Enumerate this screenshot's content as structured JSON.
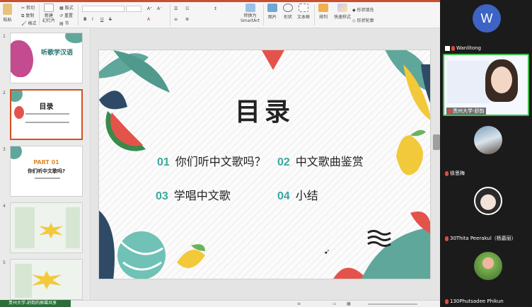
{
  "ribbon": {
    "paste_label": "粘贴",
    "cut_label": "剪切",
    "copy_label": "复制",
    "format_label": "格式",
    "new_slide_label": "新建\n幻灯片",
    "layout_label": "版式",
    "reset_label": "重置",
    "section_label": "节",
    "picture_label": "图片",
    "shape_label": "形状",
    "textbox_label": "文本框",
    "smartart_label": "转换为\nSmartArt",
    "arrange_label": "排列",
    "quickstyle_label": "快速样式",
    "shape_fill_label": "形状填充",
    "shape_outline_label": "形状轮廓",
    "accent_color": "#c8502f"
  },
  "thumbnails": [
    {
      "num": "1",
      "title": "听歌学汉语",
      "selected": false
    },
    {
      "num": "2",
      "title": "目录",
      "selected": true
    },
    {
      "num": "3",
      "title": "PART 01",
      "subtitle": "你们听中文歌吗?",
      "selected": false
    },
    {
      "num": "4",
      "title": "",
      "selected": false
    },
    {
      "num": "5",
      "title": "",
      "selected": false
    }
  ],
  "slide": {
    "title": "目录",
    "items": [
      {
        "num": "01",
        "text": "你们听中文歌吗？"
      },
      {
        "num": "02",
        "text": "中文歌曲鉴赏"
      },
      {
        "num": "03",
        "text": "学唱中文歌"
      },
      {
        "num": "04",
        "text": "小结"
      }
    ]
  },
  "status": {
    "share_label": "贵州大学-舒韵的屏幕共享"
  },
  "participants": [
    {
      "name": "Wanlitong",
      "avatar_letter": "W",
      "type": "avatar"
    },
    {
      "name": "贵州大学-舒韵",
      "type": "video"
    },
    {
      "name": "徐思梅",
      "type": "photo"
    },
    {
      "name": "30Thita Peerakul（杨嘉丽）",
      "type": "photo"
    },
    {
      "name": "130Phutsadee Phikun",
      "type": "photo"
    }
  ],
  "colors": {
    "teal": "#3aa89c",
    "leaf": "#5fa79a",
    "watermelon_red": "#e4534b",
    "mango": "#f2c93a",
    "avatar_blue": "#3d63c4"
  }
}
